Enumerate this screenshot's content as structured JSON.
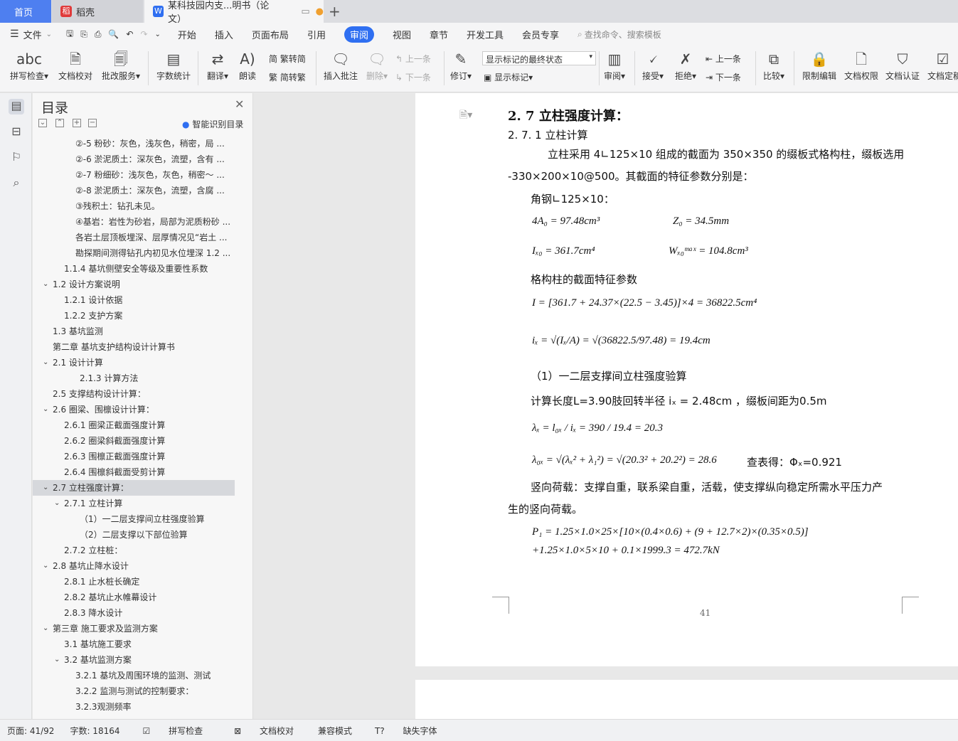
{
  "tabs": {
    "home": "首页",
    "daoke": "稻壳",
    "doc": "某科技园内支...明书（论文）"
  },
  "menu": {
    "file": "文件",
    "items": [
      "开始",
      "插入",
      "页面布局",
      "引用",
      "审阅",
      "视图",
      "章节",
      "开发工具",
      "会员专享"
    ],
    "search": "查找命令、搜索模板"
  },
  "ribbon": {
    "spell": "拼写检查",
    "proof": "文档校对",
    "annot": "批改服务",
    "wc": "字数统计",
    "tr": "翻译",
    "read": "朗读",
    "t2s": "繁转简",
    "s2t": "简转繁",
    "ins": "插入批注",
    "del": "删除",
    "prev": "上一条",
    "next": "下一条",
    "rev": "修订",
    "state": "显示标记的最终状态",
    "showmark": "显示标记",
    "review": "审阅",
    "accept": "接受",
    "reject": "拒绝",
    "prev2": "上一条",
    "next2": "下一条",
    "cmp": "比较",
    "limit": "限制编辑",
    "perm": "文档权限",
    "cert": "文档认证",
    "fix": "文档定稿"
  },
  "toc": {
    "title": "目录",
    "smart": "智能识别目录",
    "items": [
      {
        "t": "②-5 粉砂：灰色，浅灰色，稍密，局 ...",
        "l": 3,
        "a": ""
      },
      {
        "t": "②-6 淤泥质土：深灰色，流塑，含有 ...",
        "l": 3,
        "a": ""
      },
      {
        "t": "②-7 粉细砂：浅灰色，灰色，稍密～ ...",
        "l": 3,
        "a": ""
      },
      {
        "t": "②-8 淤泥质土：深灰色，流塑，含腐 ...",
        "l": 3,
        "a": ""
      },
      {
        "t": "③残积土：钻孔未见。",
        "l": 3,
        "a": ""
      },
      {
        "t": "④基岩：岩性为砂岩，局部为泥质粉砂 ...",
        "l": 3,
        "a": ""
      },
      {
        "t": "各岩土层顶板埋深、层厚情况见“岩土 ...",
        "l": 3,
        "a": ""
      },
      {
        "t": "勘探期间测得钻孔内初见水位埋深 1.2 ...",
        "l": 3,
        "a": ""
      },
      {
        "t": "1.1.4  基坑侧壁安全等级及重要性系数",
        "l": 2,
        "a": ""
      },
      {
        "t": "1.2  设计方案说明",
        "l": 1,
        "a": "v"
      },
      {
        "t": "1.2.1  设计依据",
        "l": 2,
        "a": ""
      },
      {
        "t": "1.2.2  支护方案",
        "l": 2,
        "a": ""
      },
      {
        "t": "1.3  基坑监测",
        "l": 1,
        "a": ""
      },
      {
        "t": "第二章  基坑支护结构设计计算书",
        "l": 1,
        "a": ""
      },
      {
        "t": "2.1  设计计算",
        "l": 1,
        "a": "v"
      },
      {
        "t": "2.1.3 计算方法",
        "l": 4,
        "a": ""
      },
      {
        "t": "2.5 支撑结构设计计算：",
        "l": 1,
        "a": ""
      },
      {
        "t": "2.6 圈梁、围檩设计计算：",
        "l": 1,
        "a": "v"
      },
      {
        "t": "2.6.1  圈梁正截面强度计算",
        "l": 2,
        "a": ""
      },
      {
        "t": "2.6.2  圈梁斜截面强度计算",
        "l": 2,
        "a": ""
      },
      {
        "t": "2.6.3  围檩正截面强度计算",
        "l": 2,
        "a": ""
      },
      {
        "t": "2.6.4 围檩斜截面受剪计算",
        "l": 2,
        "a": ""
      },
      {
        "t": "2.7 立柱强度计算：",
        "l": 1,
        "a": "v",
        "sel": true
      },
      {
        "t": "2.7.1 立柱计算",
        "l": 2,
        "a": "v"
      },
      {
        "t": "（1）一二层支撑间立柱强度验算",
        "l": 4,
        "a": ""
      },
      {
        "t": "（2）二层支撑以下部位验算",
        "l": 4,
        "a": ""
      },
      {
        "t": "2.7.2 立柱桩：",
        "l": 2,
        "a": ""
      },
      {
        "t": "2.8  基坑止降水设计",
        "l": 1,
        "a": "v"
      },
      {
        "t": "2.8.1 止水桩长确定",
        "l": 2,
        "a": ""
      },
      {
        "t": "2.8.2 基坑止水帷幕设计",
        "l": 2,
        "a": ""
      },
      {
        "t": "2.8.3 降水设计",
        "l": 2,
        "a": ""
      },
      {
        "t": "第三章    施工要求及监测方案",
        "l": 1,
        "a": "v"
      },
      {
        "t": "3.1    基坑施工要求",
        "l": 2,
        "a": ""
      },
      {
        "t": "3.2    基坑监测方案",
        "l": 2,
        "a": "v"
      },
      {
        "t": "3.2.1 基坑及周围环境的监测、测试",
        "l": 3,
        "a": ""
      },
      {
        "t": "3.2.2 监测与测试的控制要求：",
        "l": 3,
        "a": ""
      },
      {
        "t": "3.2.3观测频率",
        "l": 3,
        "a": ""
      }
    ]
  },
  "doc": {
    "h2": "2. 7 立柱强度计算：",
    "h3": "2. 7. 1 立柱计算",
    "p1": "立柱采用 4∟125×10 组成的截面为 350×350 的缀板式格构柱，缀板选用",
    "p1b": "-330×200×10@500。其截面的特征参数分别是：",
    "angle": "角钢∟125×10：",
    "m1a": "4A₀ = 97.48cm³",
    "m1b": "Z₀ = 34.5mm",
    "m2a": "Iₓ₀ = 361.7cm⁴",
    "m2b": "Wₓ₀ᵐᵃˣ = 104.8cm³",
    "sec": "格构柱的截面特征参数",
    "m3": "I = [361.7 + 24.37×(22.5 − 3.45)]×4 = 36822.5cm⁴",
    "m4": "iₓ = √(Iₓ/A) = √(36822.5/97.48) = 19.4cm",
    "s1": "（1）一二层支撑间立柱强度验算",
    "calc": "计算长度L=3.90肢回转半径 iₓ = 2.48cm ，缀板间距为0.5m",
    "m5": "λₓ = l₀ₓ / iₓ = 390 / 19.4 = 20.3",
    "m6": "λ₀ₓ = √(λₓ² + λ₁²) = √(20.3² + 20.2²) = 28.6",
    "chk": "查表得：Φₓ=0.921",
    "p2": "竖向荷载：支撑自重，联系梁自重，活载，使支撑纵向稳定所需水平压力产",
    "p2b": "生的竖向荷载。",
    "m7": "P₁ = 1.25×1.0×25×[10×(0.4×0.6) + (9 + 12.7×2)×(0.35×0.5)]",
    "m8": "+1.25×1.0×5×10 + 0.1×1999.3 = 472.7kN",
    "pageno": "41"
  },
  "status": {
    "page": "页面: 41/92",
    "words": "字数: 18164",
    "spell": "拼写检查",
    "proof": "文档校对",
    "compat": "兼容模式",
    "font": "缺失字体"
  },
  "colors": {
    "accent": "#2f6ff1",
    "home": "#4e7ff0"
  }
}
